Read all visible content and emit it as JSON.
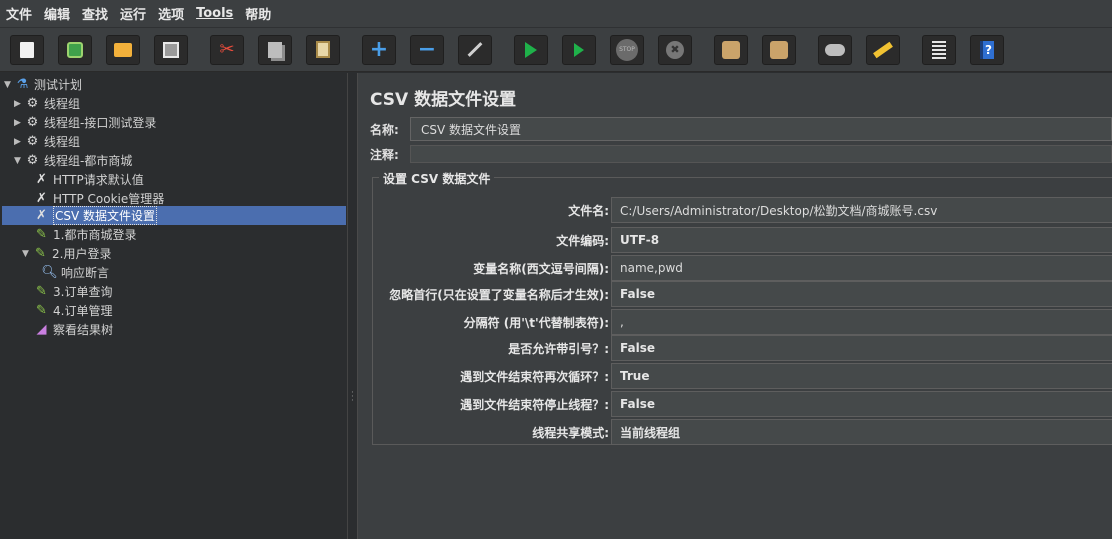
{
  "menu": [
    "文件",
    "编辑",
    "查找",
    "运行",
    "选项",
    "Tools",
    "帮助"
  ],
  "toolbar": {
    "buttons": [
      "new-icon",
      "templates-icon",
      "open-icon",
      "save-icon",
      "cut-icon",
      "copy-icon",
      "paste-icon",
      "expand-icon",
      "collapse-icon",
      "toggle-icon",
      "start-icon",
      "start-no-pause-icon",
      "stop-icon",
      "shutdown-icon",
      "clear-icon",
      "clear-all-icon",
      "search-icon",
      "reset-search-icon",
      "function-helper-icon",
      "help-icon"
    ],
    "stop_text": "STOP"
  },
  "tree": {
    "items": [
      {
        "label": "测试计划",
        "icon": "flask-icon",
        "arrow": "▼"
      },
      {
        "label": "线程组",
        "icon": "gear-icon",
        "arrow": "▶"
      },
      {
        "label": "线程组-接口测试登录",
        "icon": "gear-icon",
        "arrow": "▶"
      },
      {
        "label": "线程组",
        "icon": "gear-icon",
        "arrow": "▶"
      },
      {
        "label": "线程组-都市商城",
        "icon": "gear-icon",
        "arrow": "▼"
      },
      {
        "label": "HTTP请求默认值",
        "icon": "wrench-icon",
        "arrow": ""
      },
      {
        "label": "HTTP Cookie管理器",
        "icon": "wrench-icon",
        "arrow": ""
      },
      {
        "label": "CSV 数据文件设置",
        "icon": "wrench-icon",
        "arrow": ""
      },
      {
        "label": "1.都市商城登录",
        "icon": "pipette-icon",
        "arrow": ""
      },
      {
        "label": "2.用户登录",
        "icon": "pipette-icon",
        "arrow": "▼"
      },
      {
        "label": "响应断言",
        "icon": "magnifier-icon",
        "arrow": ""
      },
      {
        "label": "3.订单查询",
        "icon": "pipette-icon",
        "arrow": ""
      },
      {
        "label": "4.订单管理",
        "icon": "pipette-icon",
        "arrow": ""
      },
      {
        "label": "察看结果树",
        "icon": "graph-icon",
        "arrow": ""
      }
    ]
  },
  "panel": {
    "title": "CSV 数据文件设置",
    "name_label": "名称:",
    "name_value": "CSV 数据文件设置",
    "comment_label": "注释:",
    "group_title": "设置 CSV 数据文件",
    "fields": [
      {
        "label": "文件名:",
        "value": "C:/Users/Administrator/Desktop/松勤文档/商城账号.csv"
      },
      {
        "label": "文件编码:",
        "value": "UTF-8"
      },
      {
        "label": "变量名称(西文逗号间隔):",
        "value": "name,pwd"
      },
      {
        "label": "忽略首行(只在设置了变量名称后才生效):",
        "value": "False"
      },
      {
        "label": "分隔符 (用'\\t'代替制表符):",
        "value": ","
      },
      {
        "label": "是否允许带引号？:",
        "value": "False"
      },
      {
        "label": "遇到文件结束符再次循环？:",
        "value": "True"
      },
      {
        "label": "遇到文件结束符停止线程？:",
        "value": "False"
      },
      {
        "label": "线程共享模式:",
        "value": "当前线程组"
      }
    ]
  }
}
